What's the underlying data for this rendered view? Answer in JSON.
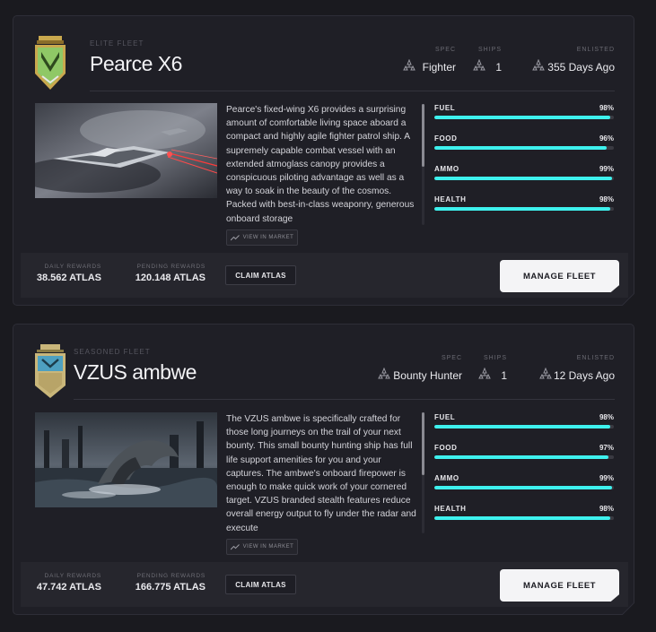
{
  "fleets": [
    {
      "tier": "ELITE FLEET",
      "name": "Pearce X6",
      "spec_label": "SPEC",
      "spec": "Fighter",
      "ships_label": "SHIPS",
      "ships": "1",
      "enlisted_label": "ENLISTED",
      "enlisted": "355 Days Ago",
      "description": "Pearce's fixed-wing X6 provides a surprising amount of comfortable living space aboard a compact and highly agile fighter patrol ship. A supremely capable combat vessel with an extended atmoglass canopy provides a conspicuous piloting advantage as well as a way to soak in the beauty of the cosmos. Packed with best-in-class weaponry, generous onboard storage",
      "view_in_market": "VIEW IN MARKET",
      "stats": [
        {
          "label": "FUEL",
          "value": "98%",
          "level": 98
        },
        {
          "label": "FOOD",
          "value": "96%",
          "level": 96
        },
        {
          "label": "AMMO",
          "value": "99%",
          "level": 99
        },
        {
          "label": "HEALTH",
          "value": "98%",
          "level": 98
        }
      ],
      "daily_rewards_label": "DAILY REWARDS",
      "daily_rewards": "38.562 ATLAS",
      "pending_rewards_label": "PENDING REWARDS",
      "pending_rewards": "120.148 ATLAS",
      "claim_label": "CLAIM ATLAS",
      "manage_label": "MANAGE FLEET"
    },
    {
      "tier": "SEASONED FLEET",
      "name": "VZUS ambwe",
      "spec_label": "SPEC",
      "spec": "Bounty Hunter",
      "ships_label": "SHIPS",
      "ships": "1",
      "enlisted_label": "ENLISTED",
      "enlisted": "12 Days Ago",
      "description": "The VZUS ambwe is specifically crafted for those long journeys on the trail of your next bounty. This small bounty hunting ship has full life support amenities for you and your captures. The ambwe's onboard firepower is enough to make quick work of your cornered target. VZUS branded stealth features reduce overall energy output to fly under the radar and execute",
      "view_in_market": "VIEW IN MARKET",
      "stats": [
        {
          "label": "FUEL",
          "value": "98%",
          "level": 98
        },
        {
          "label": "FOOD",
          "value": "97%",
          "level": 97
        },
        {
          "label": "AMMO",
          "value": "99%",
          "level": 99
        },
        {
          "label": "HEALTH",
          "value": "98%",
          "level": 98
        }
      ],
      "daily_rewards_label": "DAILY REWARDS",
      "daily_rewards": "47.742 ATLAS",
      "pending_rewards_label": "PENDING REWARDS",
      "pending_rewards": "166.775 ATLAS",
      "claim_label": "CLAIM ATLAS",
      "manage_label": "MANAGE FLEET"
    }
  ],
  "colors": {
    "accent": "#3ef1ee",
    "background": "#1a1a1f",
    "card": "#1f1f26"
  },
  "icons": {
    "stat": "ship-cluster-icon",
    "market": "trending-up-icon"
  }
}
